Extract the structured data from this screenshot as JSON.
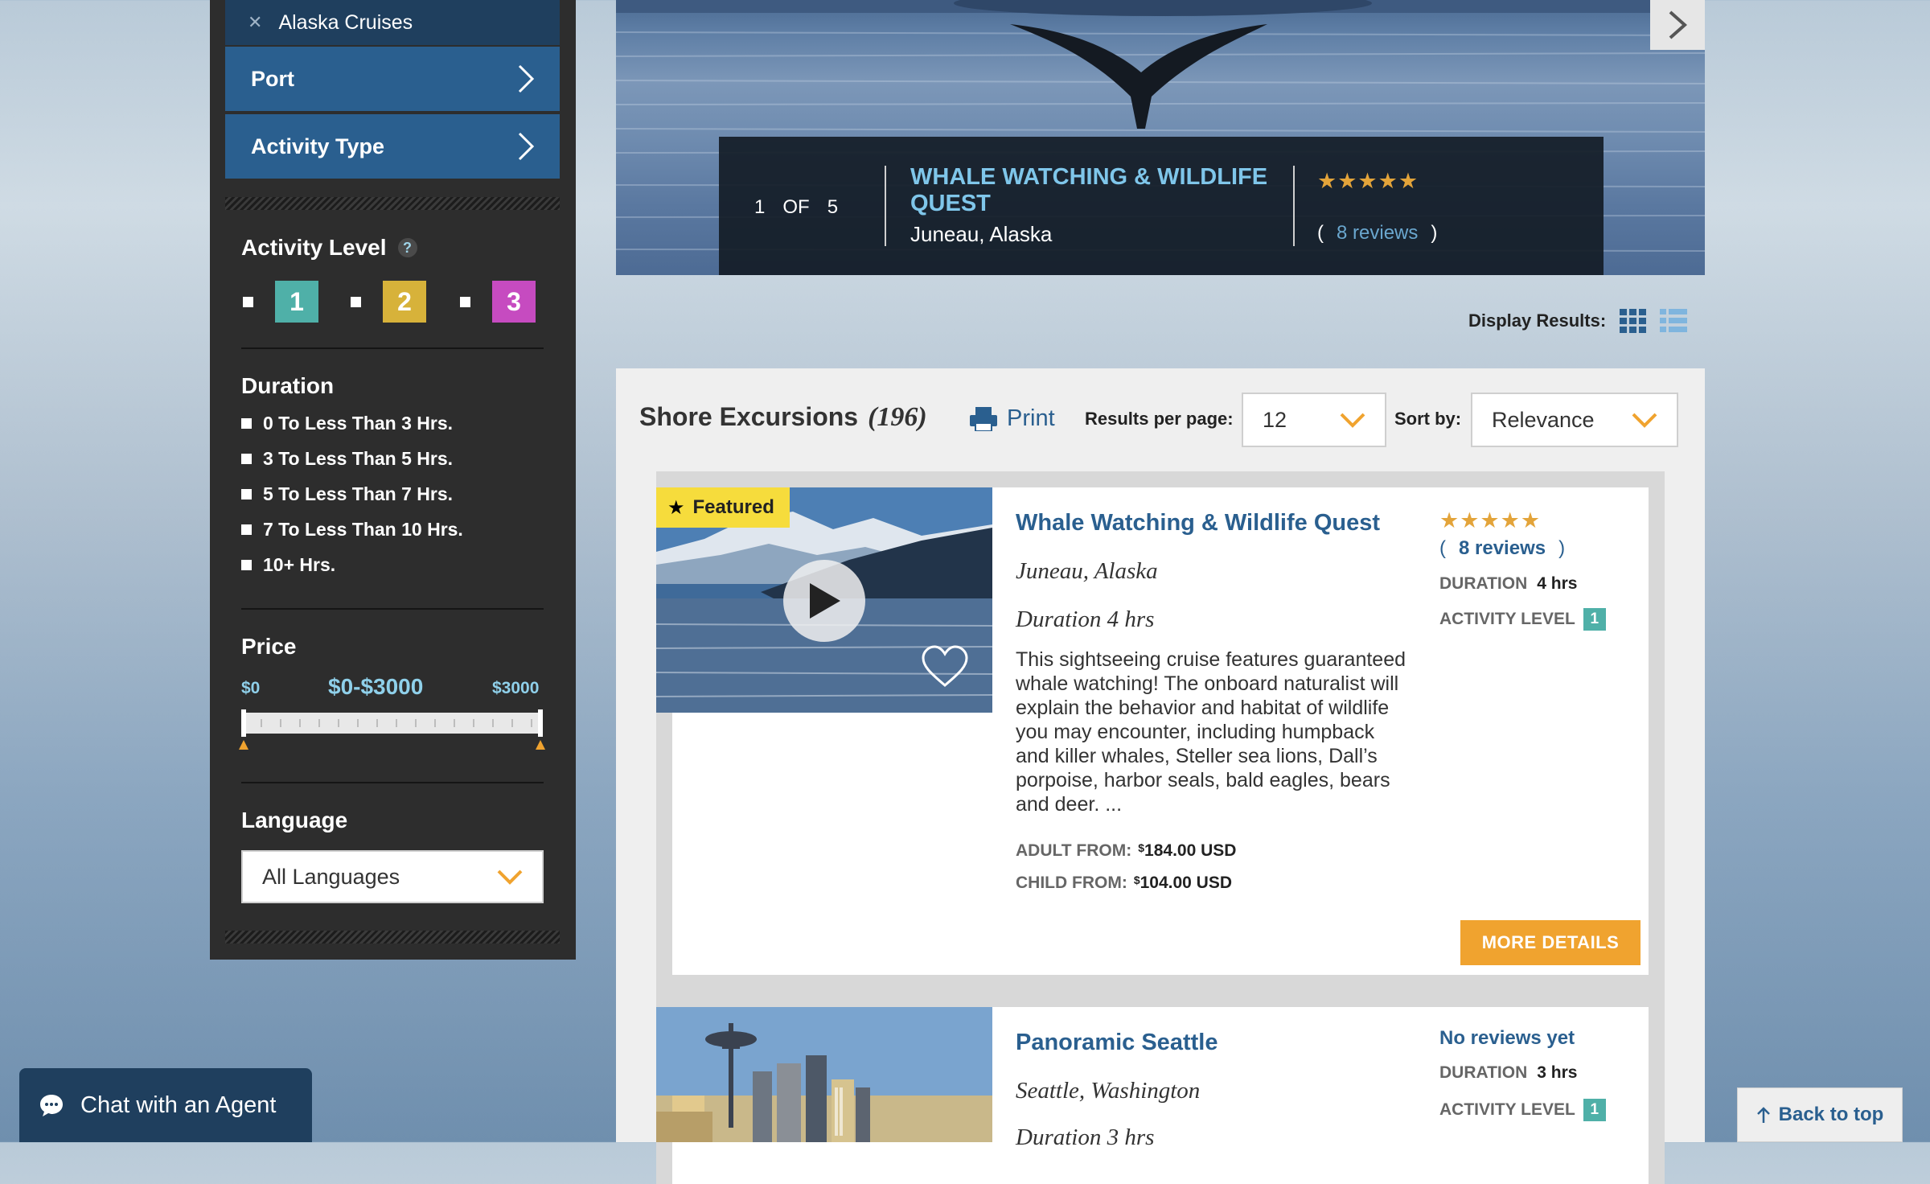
{
  "sidebar": {
    "chip": "Alaska Cruises",
    "nav": [
      "Port",
      "Activity Type"
    ],
    "activity_level": {
      "title": "Activity Level",
      "help": "?",
      "levels": [
        "1",
        "2",
        "3"
      ],
      "colors": [
        "#4fb0a8",
        "#d7b23a",
        "#c64bc0"
      ]
    },
    "duration": {
      "title": "Duration",
      "options": [
        "0 To Less Than 3 Hrs.",
        "3 To Less Than 5 Hrs.",
        "5 To Less Than 7 Hrs.",
        "7 To Less Than 10 Hrs.",
        "10+ Hrs."
      ]
    },
    "price": {
      "title": "Price",
      "min": "$0",
      "range": "$0-$3000",
      "max": "$3000"
    },
    "language": {
      "title": "Language",
      "selected": "All Languages"
    }
  },
  "hero": {
    "index": "1",
    "of": "OF",
    "total": "5",
    "title": "WHALE WATCHING & WILDLIFE QUEST",
    "location": "Juneau, Alaska",
    "stars": "★★★★★",
    "reviews_open": "(",
    "reviews": "8 reviews",
    "reviews_close": ")"
  },
  "display_results_label": "Display Results:",
  "toolbar": {
    "heading": "Shore Excursions",
    "count": "(196)",
    "print": "Print",
    "per_page_label": "Results per page:",
    "per_page": "12",
    "sort_label": "Sort by:",
    "sort": "Relevance"
  },
  "results": [
    {
      "featured": "Featured",
      "title": "Whale Watching & Wildlife Quest",
      "location": "Juneau, Alaska",
      "duration_text": "Duration 4 hrs",
      "description": "This sightseeing cruise features guaranteed whale watching! The onboard naturalist will explain the behavior and habitat of wildlife you may encounter, including humpback and killer whales, Steller sea lions, Dall’s porpoise, harbor seals, bald eagles, bears and deer. ...",
      "adult_label": "ADULT FROM:",
      "adult_sup": "$",
      "adult_price": "184.00 USD",
      "child_label": "CHILD FROM:",
      "child_sup": "$",
      "child_price": "104.00 USD",
      "stars": "★★★★★",
      "reviews_open": "(",
      "reviews": "8 reviews",
      "reviews_close": ")",
      "duration_label": "DURATION",
      "duration": "4 hrs",
      "level_label": "ACTIVITY LEVEL",
      "level": "1",
      "more": "MORE DETAILS"
    },
    {
      "title": "Panoramic Seattle",
      "location": "Seattle, Washington",
      "duration_text": "Duration 3 hrs",
      "reviews": "No reviews yet",
      "duration_label": "DURATION",
      "duration": "3 hrs",
      "level_label": "ACTIVITY LEVEL",
      "level": "1"
    }
  ],
  "chat": "Chat with an Agent",
  "back_to_top": "Back to top"
}
